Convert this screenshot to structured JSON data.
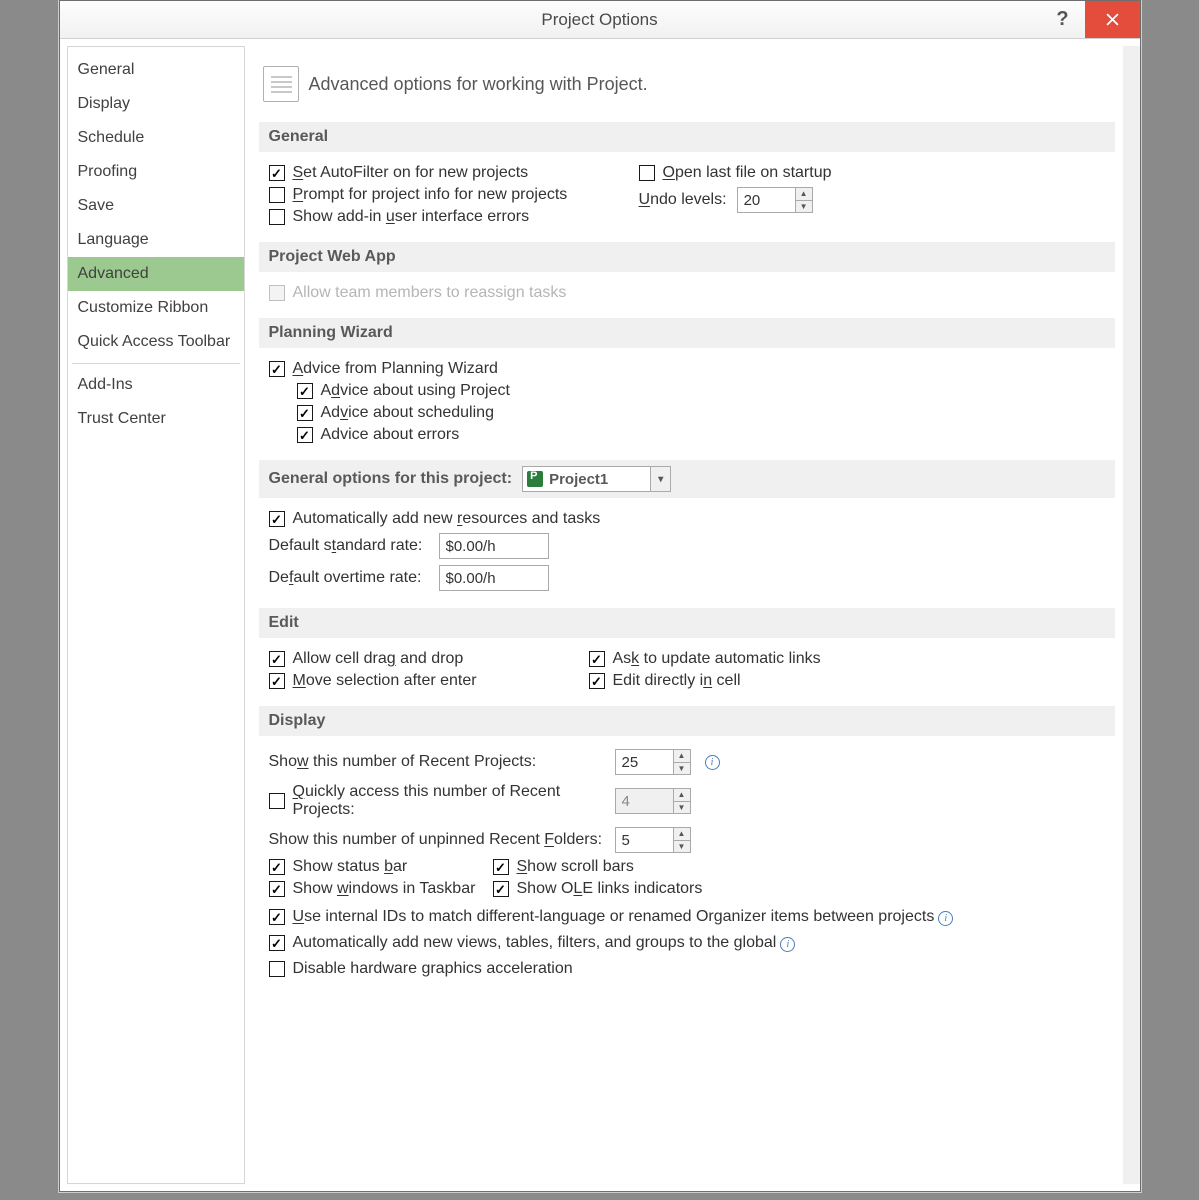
{
  "window": {
    "title": "Project Options"
  },
  "sidebar": {
    "items": [
      {
        "label": "General",
        "selected": false
      },
      {
        "label": "Display",
        "selected": false
      },
      {
        "label": "Schedule",
        "selected": false
      },
      {
        "label": "Proofing",
        "selected": false
      },
      {
        "label": "Save",
        "selected": false
      },
      {
        "label": "Language",
        "selected": false
      },
      {
        "label": "Advanced",
        "selected": true
      },
      {
        "label": "Customize Ribbon",
        "selected": false
      },
      {
        "label": "Quick Access Toolbar",
        "selected": false
      }
    ],
    "items2": [
      {
        "label": "Add-Ins"
      },
      {
        "label": "Trust Center"
      }
    ]
  },
  "heading": "Advanced options for working with Project.",
  "sections": {
    "general": {
      "title": "General",
      "autofilter": {
        "label_pre": "",
        "u": "S",
        "label": "et AutoFilter on for new projects",
        "checked": true
      },
      "prompt": {
        "u": "P",
        "label": "rompt for project info for new projects",
        "checked": false
      },
      "show_addin": {
        "label_pre": "Show add-in ",
        "u": "u",
        "label": "ser interface errors",
        "checked": false
      },
      "open_last": {
        "u": "O",
        "label": "pen last file on startup",
        "checked": false
      },
      "undo_label": {
        "u": "U",
        "label": "ndo levels:"
      },
      "undo_value": "20"
    },
    "pwa": {
      "title": "Project Web App",
      "allow_reassign": {
        "label": "Allow team members to reassign tasks",
        "checked": false,
        "disabled": true
      }
    },
    "wizard": {
      "title": "Planning Wizard",
      "advice_main": {
        "u": "A",
        "label": "dvice from Planning Wizard",
        "checked": true
      },
      "advice_using": {
        "label_pre": "A",
        "u": "d",
        "label": "vice about using Project",
        "checked": true
      },
      "advice_sched": {
        "label_pre": "Ad",
        "u": "v",
        "label": "ice about scheduling",
        "checked": true
      },
      "advice_err": {
        "label": "Advice about errors",
        "checked": true
      }
    },
    "general_proj": {
      "title": "General options for this project:",
      "project_name": "Project1",
      "auto_add": {
        "label_pre": "Automatically add new ",
        "u": "r",
        "label": "esources and tasks",
        "checked": true
      },
      "std_rate_label": {
        "label_pre": "Default s",
        "u": "t",
        "label": "andard rate:"
      },
      "std_rate_value": "$0.00/h",
      "ovt_rate_label": {
        "label_pre": "De",
        "u": "f",
        "label": "ault overtime rate:"
      },
      "ovt_rate_value": "$0.00/h"
    },
    "edit": {
      "title": "Edit",
      "drag": {
        "label_pre": "Allow cell dra",
        "u": "g",
        "label": " and drop",
        "checked": true
      },
      "move": {
        "u": "M",
        "label": "ove selection after enter",
        "checked": true
      },
      "ask": {
        "label_pre": "As",
        "u": "k",
        "label": " to update automatic links",
        "checked": true
      },
      "direct": {
        "label_pre": "Edit directly i",
        "u": "n",
        "label": " cell",
        "checked": true
      }
    },
    "display": {
      "title": "Display",
      "recent_proj_label": {
        "label_pre": "Sho",
        "u": "w",
        "label": " this number of Recent Projects:"
      },
      "recent_proj_value": "25",
      "quick_access": {
        "u": "Q",
        "label": "uickly access this number of Recent Projects:",
        "checked": false
      },
      "quick_access_value": "4",
      "recent_folders_label": {
        "label_pre": "Show this number of unpinned Recent ",
        "u": "F",
        "label": "olders:"
      },
      "recent_folders_value": "5",
      "status_bar": {
        "label_pre": "Show status ",
        "u": "b",
        "label": "ar",
        "checked": true
      },
      "windows_taskbar": {
        "label_pre": "Show ",
        "u": "w",
        "label": "indows in Taskbar",
        "checked": true
      },
      "scroll_bars": {
        "u": "S",
        "label": "how scroll bars",
        "checked": true
      },
      "ole": {
        "label_pre": "Show O",
        "u": "L",
        "label": "E links indicators",
        "checked": true
      },
      "internal_ids": {
        "u": "U",
        "label": "se internal IDs to match different-language or renamed Organizer items between projects",
        "checked": true
      },
      "auto_views": {
        "label": "Automatically add new views, tables, filters, and groups to the global",
        "checked": true
      },
      "disable_hw": {
        "label": "Disable hardware graphics acceleration",
        "checked": false
      }
    }
  }
}
